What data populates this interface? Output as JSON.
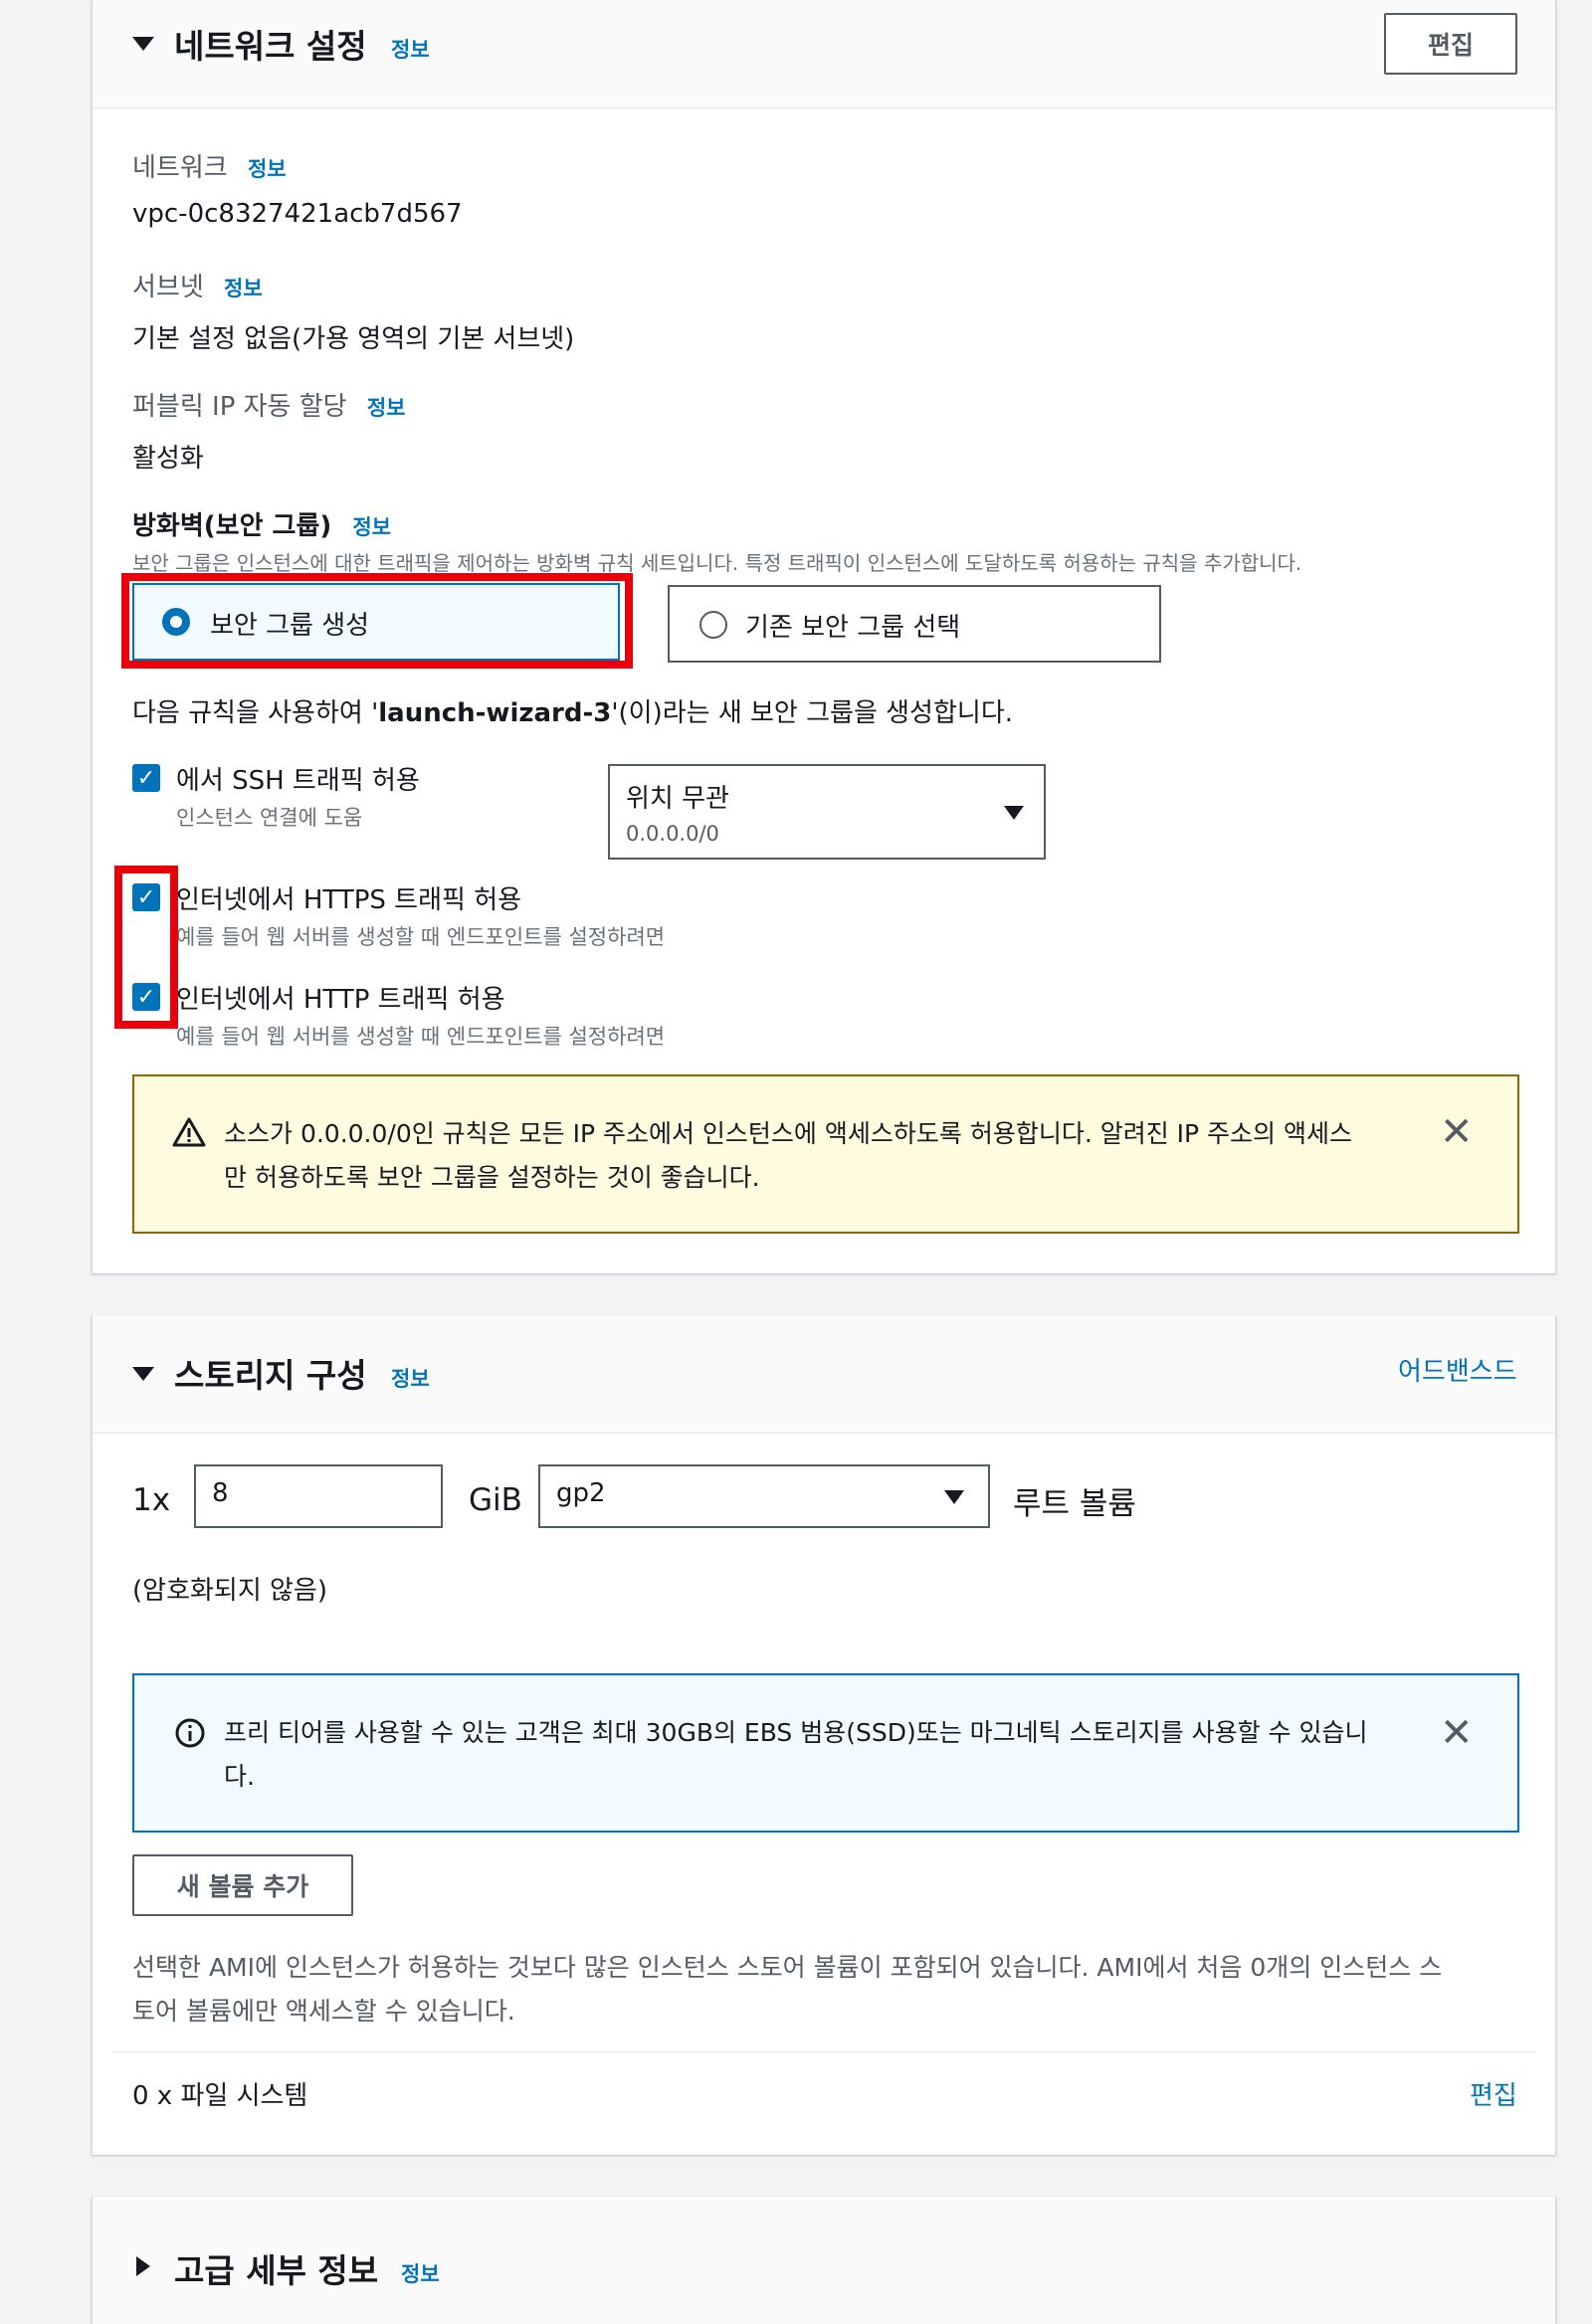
{
  "network": {
    "title": "네트워크 설정",
    "info": "정보",
    "edit_button": "편집",
    "network_label": "네트워크",
    "network_value": "vpc-0c8327421acb7d567",
    "subnet_label": "서브넷",
    "subnet_value": "기본 설정 없음(가용 영역의 기본 서브넷)",
    "public_ip_label": "퍼블릭 IP 자동 할당",
    "public_ip_value": "활성화",
    "firewall_label": "방화벽(보안 그룹)",
    "firewall_desc": "보안 그룹은 인스턴스에 대한 트래픽을 제어하는 방화벽 규칙 세트입니다. 특정 트래픽이 인스턴스에 도달하도록 허용하는 규칙을 추가합니다.",
    "radio_create": "보안 그룹 생성",
    "radio_existing": "기존 보안 그룹 선택",
    "rule_intro_prefix": "다음 규칙을 사용하여 '",
    "rule_intro_name": "launch-wizard-3",
    "rule_intro_suffix": "'(이)라는 새 보안 그룹을 생성합니다.",
    "ssh_label": "에서 SSH 트래픽 허용",
    "ssh_help": "인스턴스 연결에 도움",
    "source_select_label": "위치 무관",
    "source_select_value": "0.0.0.0/0",
    "https_label": "인터넷에서 HTTPS 트래픽 허용",
    "https_help": "예를 들어 웹 서버를 생성할 때 엔드포인트를 설정하려면",
    "http_label": "인터넷에서 HTTP 트래픽 허용",
    "http_help": "예를 들어 웹 서버를 생성할 때 엔드포인트를 설정하려면",
    "warning_line1": "소스가 0.0.0.0/0인 규칙은 모든 IP 주소에서 인스턴스에 액세스하도록 허용합니다. 알려진 IP 주소의 액세스",
    "warning_line2": "만 허용하도록 보안 그룹을 설정하는 것이 좋습니다."
  },
  "storage": {
    "title": "스토리지 구성",
    "info": "정보",
    "advanced_link": "어드밴스드",
    "multiplier": "1x",
    "size_value": "8",
    "unit": "GiB",
    "volume_type": "gp2",
    "root_volume_label": "루트 볼륨",
    "encryption_note": "(암호화되지 않음)",
    "info_line1": "프리 티어를 사용할 수 있는 고객은 최대 30GB의 EBS 범용(SSD)또는 마그네틱 스토리지를 사용할 수 있습니",
    "info_line2": "다.",
    "add_volume_button": "새 볼륨 추가",
    "ami_note_line1": "선택한 AMI에 인스턴스가 허용하는 것보다 많은 인스턴스 스토어 볼륨이 포함되어 있습니다. AMI에서 처음 0개의 인스턴스 스",
    "ami_note_line2": "토어 볼륨에만 액세스할 수 있습니다.",
    "filesystem_label": "0 x 파일 시스템",
    "filesystem_edit": "편집"
  },
  "advanced": {
    "title": "고급 세부 정보",
    "info": "정보"
  },
  "colors": {
    "accent": "#0073bb",
    "highlight": "#e8000b",
    "warning_bg": "#fffbdf",
    "warning_border": "#8d6605",
    "info_bg": "#f1faff"
  }
}
